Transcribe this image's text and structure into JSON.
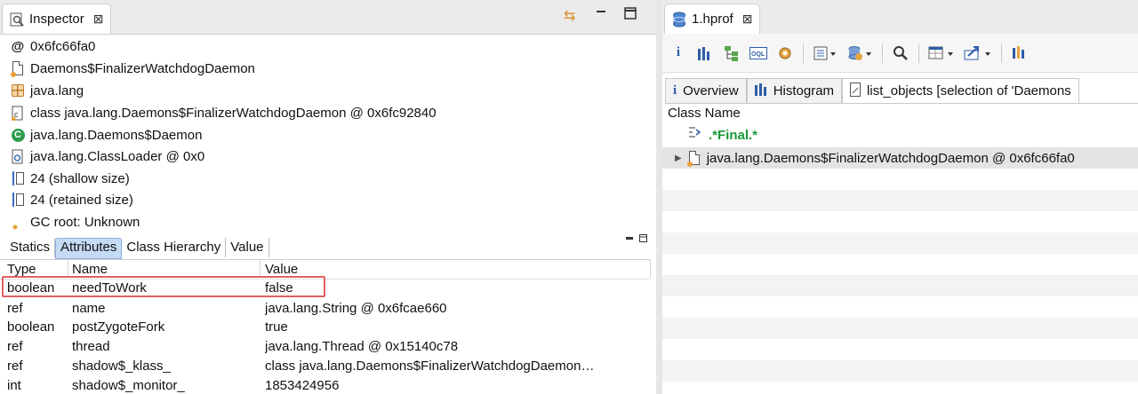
{
  "inspector": {
    "title": "Inspector",
    "close_glyph": "⊠",
    "controls": {
      "sync_icon": "⇆",
      "minimize": "▭",
      "maximize": "⊡"
    },
    "info": [
      {
        "icon": "at-icon",
        "text": "0x6fc66fa0"
      },
      {
        "icon": "class-file-icon",
        "text": "Daemons$FinalizerWatchdogDaemon"
      },
      {
        "icon": "package-icon",
        "text": "java.lang"
      },
      {
        "icon": "class-c-icon",
        "text": "class java.lang.Daemons$FinalizerWatchdogDaemon @ 0x6fc92840"
      },
      {
        "icon": "superclass-icon",
        "text": "java.lang.Daemons$Daemon"
      },
      {
        "icon": "classloader-icon",
        "text": "java.lang.ClassLoader @ 0x0"
      },
      {
        "icon": "shallow-size-icon",
        "text": "24 (shallow size)"
      },
      {
        "icon": "retained-size-icon",
        "text": "24 (retained size)"
      },
      {
        "icon": "gc-root-icon",
        "text": "GC root: Unknown"
      }
    ],
    "tabs": [
      "Statics",
      "Attributes",
      "Class Hierarchy",
      "Value"
    ],
    "active_tab": "Attributes",
    "table": {
      "headers": {
        "type": "Type",
        "name": "Name",
        "value": "Value"
      },
      "rows": [
        {
          "type": "boolean",
          "name": "needToWork",
          "value": "false"
        },
        {
          "type": "ref",
          "name": "name",
          "value": "java.lang.String @ 0x6fcae660"
        },
        {
          "type": "boolean",
          "name": "postZygoteFork",
          "value": "true"
        },
        {
          "type": "ref",
          "name": "thread",
          "value": "java.lang.Thread @ 0x15140c78"
        },
        {
          "type": "ref",
          "name": "shadow$_klass_",
          "value": "class java.lang.Daemons$FinalizerWatchdogDaemon…"
        },
        {
          "type": "int",
          "name": "shadow$_monitor_",
          "value": "1853424956"
        }
      ]
    }
  },
  "editor": {
    "file_tab": "1.hprof",
    "close_glyph": "⊠",
    "toolbar": [
      "i",
      "histogram",
      "dominator",
      "oql",
      "gear",
      "grid",
      "db",
      "search",
      "table",
      "export",
      "calc"
    ],
    "tabs": [
      {
        "icon": "i",
        "label": "Overview"
      },
      {
        "icon": "histogram",
        "label": "Histogram"
      },
      {
        "icon": "doc",
        "label": "list_objects [selection of 'Daemons"
      }
    ],
    "column_header": "Class Name",
    "filter_row": ".*Final.*",
    "result_row": "java.lang.Daemons$FinalizerWatchdogDaemon @ 0x6fc66fa0"
  },
  "colors": {
    "highlight_border": "#e06060",
    "active_tab": "#c5daf5",
    "filter_text": "#1a9a3a"
  }
}
